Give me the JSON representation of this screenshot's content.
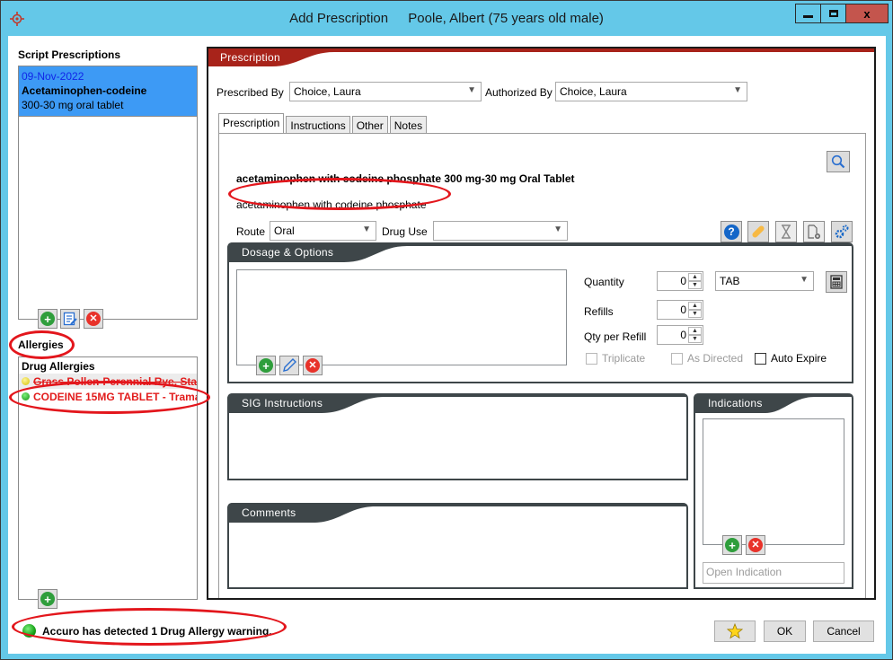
{
  "window": {
    "title": "Add Prescription",
    "patient": "Poole, Albert (75 years old male)",
    "controls": {
      "minimize": "minimize",
      "maximize": "maximize",
      "close": "x"
    }
  },
  "left_panel": {
    "script_prescriptions_label": "Script Prescriptions",
    "prescriptions": [
      {
        "date": "09-Nov-2022",
        "name": "Acetaminophen-codeine",
        "description": "300-30 mg oral tablet",
        "selected": true
      }
    ],
    "rx_buttons": [
      "add-icon",
      "edit-list-icon",
      "delete-icon"
    ],
    "allergies_label": "Allergies",
    "allergy_list_header": "Drug Allergies",
    "allergies": [
      {
        "text": "Grass Pollen-Perennial Rye, Sta",
        "indicator": "yellow",
        "strikethrough": true
      },
      {
        "text": "CODEINE 15MG TABLET - Trama",
        "indicator": "green",
        "strikethrough": false
      }
    ],
    "allergy_buttons": [
      "add-icon"
    ]
  },
  "prescription_panel": {
    "header": "Prescription",
    "prescribed_by_label": "Prescribed By",
    "prescribed_by_value": "Choice, Laura",
    "authorized_by_label": "Authorized By",
    "authorized_by_value": "Choice, Laura",
    "tabs": [
      {
        "label": "Prescription",
        "active": true
      },
      {
        "label": "Instructions",
        "active": false
      },
      {
        "label": "Other",
        "active": false
      },
      {
        "label": "Notes",
        "active": false
      }
    ],
    "drug_full_name": "acetaminophen with codeine phosphate 300 mg-30 mg Oral Tablet",
    "drug_generic_name": "acetaminophen with codeine phosphate",
    "route_label": "Route",
    "route_value": "Oral",
    "drug_use_label": "Drug Use",
    "drug_use_value": "",
    "toolbar_icons": [
      "help-icon",
      "pill-icon",
      "hourglass-icon",
      "new-document-icon",
      "settings-icon"
    ],
    "search_icon": "search-icon"
  },
  "dosage": {
    "title": "Dosage & Options",
    "quantity_label": "Quantity",
    "quantity_value": "0",
    "unit_value": "TAB",
    "refills_label": "Refills",
    "refills_value": "0",
    "qty_per_refill_label": "Qty per Refill",
    "qty_per_refill_value": "0",
    "triplicate_label": "Triplicate",
    "triplicate_checked": false,
    "as_directed_label": "As Directed",
    "as_directed_checked": false,
    "auto_expire_label": "Auto Expire",
    "auto_expire_checked": false
  },
  "sig": {
    "title": "SIG Instructions"
  },
  "comments": {
    "title": "Comments"
  },
  "indications": {
    "title": "Indications",
    "open_indication_placeholder": "Open Indication"
  },
  "status": {
    "message": "Accuro has detected 1 Drug Allergy warning."
  },
  "footer": {
    "ok_label": "OK",
    "cancel_label": "Cancel",
    "favorite_icon": "star-icon"
  },
  "colors": {
    "titlebar": "#64c8e8",
    "header_red": "#a8231a",
    "group_header": "#3e4649",
    "selection": "#3d9af5",
    "allergy_text": "#e21c1c",
    "annotation_red": "#e3161c"
  }
}
